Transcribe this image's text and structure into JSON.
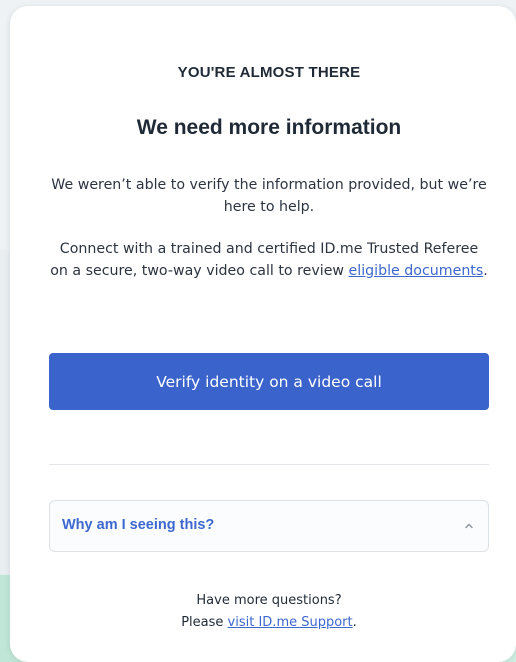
{
  "header": {
    "eyebrow": "YOU'RE ALMOST THERE",
    "title": "We need more information"
  },
  "intro": {
    "text": "We weren’t able to verify the information provided, but we’re here to help."
  },
  "details": {
    "text_before_link": "Connect with a trained and certified ID.me Trusted Referee on a secure, two-way video call to review ",
    "link_label": "eligible documents",
    "text_after_link": "."
  },
  "primary_action": {
    "label": "Verify identity on a video call",
    "color": "#3a63cc"
  },
  "accordion": {
    "label": "Why am I seeing this?",
    "icon": "chevron-up-icon"
  },
  "footer": {
    "line1": "Have more questions?",
    "line2_prefix": "Please ",
    "link_label": "visit ID.me Support",
    "line2_suffix": "."
  },
  "colors": {
    "link": "#3d68cf",
    "text": "#1f2a36",
    "background": "#e9eef0"
  }
}
